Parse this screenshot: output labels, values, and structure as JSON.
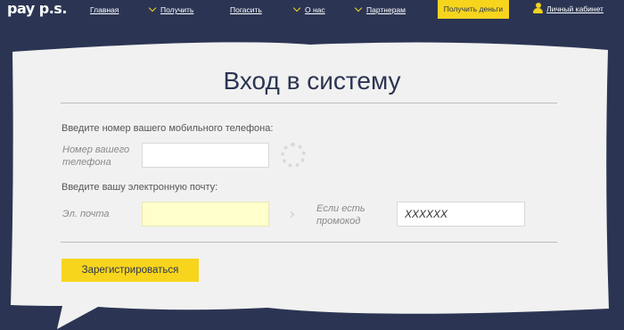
{
  "header": {
    "logo": "pay p.s.",
    "nav": [
      {
        "label": "Главная",
        "dropdown": false
      },
      {
        "label": "Получить",
        "dropdown": true
      },
      {
        "label": "Погасить",
        "dropdown": false
      },
      {
        "label": "О нас",
        "dropdown": true
      },
      {
        "label": "Партнерам",
        "dropdown": true
      }
    ],
    "get_money_label": "Получить деньги",
    "cabinet_label": "Личный кабинет"
  },
  "form": {
    "title": "Вход в систему",
    "phone_prompt": "Введите номер вашего мобильного телефона:",
    "phone_label": "Номер вашего телефона",
    "phone_value": "",
    "email_prompt": "Введите вашу электронную почту:",
    "email_label": "Эл. почта",
    "email_value": "",
    "promo_label": "Если есть промокод",
    "promo_placeholder": "XXXXXX",
    "register_label": "Зарегистрироваться"
  },
  "colors": {
    "background": "#2b3553",
    "accent_yellow": "#f7d51d",
    "card": "#f1f1f1",
    "email_highlight": "#ffffcc"
  },
  "icons": [
    "user-icon",
    "chevron-down-icon",
    "loading-spinner-icon",
    "chevron-right-icon"
  ]
}
